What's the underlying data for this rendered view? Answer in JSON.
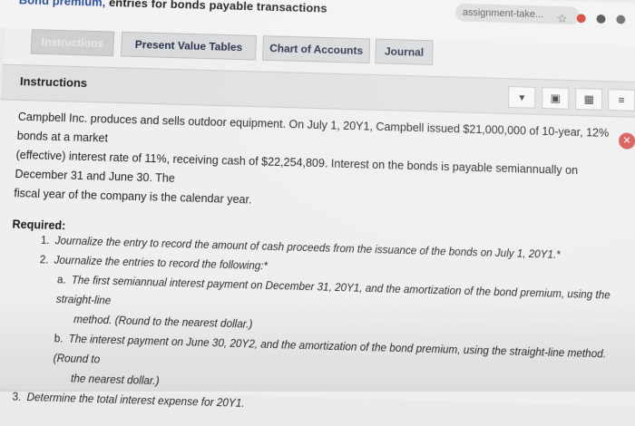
{
  "browser": {
    "url_text": "assignment-take...",
    "star_icon": "star-icon"
  },
  "header": {
    "title_blue": "Bond premium,",
    "title_rest": " entries for bonds payable transactions"
  },
  "tabs": [
    {
      "label": "Instructions",
      "disabled": true
    },
    {
      "label": "Present Value Tables"
    },
    {
      "label": "Chart of Accounts"
    },
    {
      "label": "Journal"
    }
  ],
  "instructions_bar": {
    "label": "Instructions"
  },
  "content": {
    "intro_part1": "Campbell Inc. produces and sells outdoor equipment. On July 1, 20Y1, Campbell issued $21,000,000 of 10-year, 12% bonds at a market",
    "intro_part2": "(effective) interest rate of 11%, receiving cash of $22,254,809. Interest on the bonds is payable semiannually on December 31 and June 30. The",
    "intro_part3": "fiscal year of the company is the calendar year.",
    "required_label": "Required:",
    "items": [
      {
        "num": "1.",
        "text": "Journalize the entry to record the amount of cash proceeds from the issuance of the bonds on July 1, 20Y1.*"
      },
      {
        "num": "2.",
        "text": "Journalize the entries to record the following:*"
      },
      {
        "num": "a.",
        "text": "The first semiannual interest payment on December 31, 20Y1, and the amortization of the bond premium, using the straight-line"
      },
      {
        "num": "",
        "text": "method. (Round to the nearest dollar.)"
      },
      {
        "num": "b.",
        "text": "The interest payment on June 30, 20Y2, and the amortization of the bond premium, using the straight-line method. (Round to"
      },
      {
        "num": "",
        "text": "the nearest dollar.)"
      },
      {
        "num": "3.",
        "text": "Determine the total interest expense for 20Y1."
      }
    ]
  }
}
